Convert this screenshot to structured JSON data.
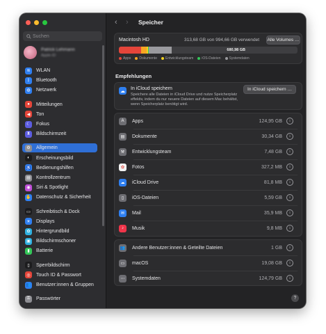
{
  "window": {
    "title": "Speicher"
  },
  "sidebar": {
    "search_placeholder": "Suchen",
    "profile": {
      "name": "Patrick Lehmann",
      "subtitle": "Apple-ID"
    },
    "groups": [
      [
        {
          "label": "WLAN",
          "icon": "wifi-icon",
          "color": "#2f7ff0",
          "glyph": "≋"
        },
        {
          "label": "Bluetooth",
          "icon": "bluetooth-icon",
          "color": "#2f7ff0",
          "glyph": "ᛒ"
        },
        {
          "label": "Netzwerk",
          "icon": "globe-icon",
          "color": "#2f7ff0",
          "glyph": "◍"
        }
      ],
      [
        {
          "label": "Mitteilungen",
          "icon": "bell-icon",
          "color": "#e5453a",
          "glyph": "●"
        },
        {
          "label": "Ton",
          "icon": "speaker-icon",
          "color": "#e5453a",
          "glyph": "◀"
        },
        {
          "label": "Fokus",
          "icon": "moon-icon",
          "color": "#5c5ce0",
          "glyph": "☾"
        },
        {
          "label": "Bildschirmzeit",
          "icon": "hourglass-icon",
          "color": "#5c5ce0",
          "glyph": "⧗"
        }
      ],
      [
        {
          "label": "Allgemein",
          "icon": "gear-icon",
          "color": "#8e8e93",
          "glyph": "⚙",
          "selected": true
        },
        {
          "label": "Erscheinungsbild",
          "icon": "appearance-icon",
          "color": "#1c1c1e",
          "glyph": "◐"
        },
        {
          "label": "Bedienungshilfen",
          "icon": "accessibility-icon",
          "color": "#2f7ff0",
          "glyph": "♿"
        },
        {
          "label": "Kontrollzentrum",
          "icon": "control-center-icon",
          "color": "#8e8e93",
          "glyph": "▤"
        },
        {
          "label": "Siri & Spotlight",
          "icon": "siri-icon",
          "color": "#c04fd8",
          "glyph": "◉"
        },
        {
          "label": "Datenschutz & Sicherheit",
          "icon": "hand-icon",
          "color": "#2f7ff0",
          "glyph": "✋"
        }
      ],
      [
        {
          "label": "Schreibtisch & Dock",
          "icon": "dock-icon",
          "color": "#1c1c1e",
          "glyph": "▭"
        },
        {
          "label": "Displays",
          "icon": "display-icon",
          "color": "#2f7ff0",
          "glyph": "☀"
        },
        {
          "label": "Hintergrundbild",
          "icon": "wallpaper-icon",
          "color": "#2fb0e0",
          "glyph": "✿"
        },
        {
          "label": "Bildschirmschoner",
          "icon": "screensaver-icon",
          "color": "#2fb0e0",
          "glyph": "▣"
        },
        {
          "label": "Batterie",
          "icon": "battery-icon",
          "color": "#34c759",
          "glyph": "▮"
        }
      ],
      [
        {
          "label": "Sperrbildschirm",
          "icon": "lock-screen-icon",
          "color": "#1c1c1e",
          "glyph": "▯"
        },
        {
          "label": "Touch ID & Passwort",
          "icon": "fingerprint-icon",
          "color": "#e5453a",
          "glyph": "◎"
        },
        {
          "label": "Benutzer:innen & Gruppen",
          "icon": "users-icon",
          "color": "#2f7ff0",
          "glyph": "👥"
        }
      ],
      [
        {
          "label": "Passwörter",
          "icon": "key-icon",
          "color": "#8e8e93",
          "glyph": "⚿"
        }
      ]
    ]
  },
  "disk": {
    "name": "Macintosh HD",
    "usage": "313,68 GB von 994,66 GB verwendet",
    "all_volumes_button": "Alle Volumes …",
    "free_label": "680,98 GB",
    "used_fraction": 0.315,
    "segments": [
      {
        "name": "Apps",
        "color": "#e5453a",
        "fraction": 0.1255
      },
      {
        "name": "Dokumente",
        "color": "#f5a623",
        "fraction": 0.0305
      },
      {
        "name": "Entwicklungsteam",
        "color": "#f0d020",
        "fraction": 0.0075
      },
      {
        "name": "iOS-Dateien",
        "color": "#34c759",
        "fraction": 0.0056
      },
      {
        "name": "Systemdaten",
        "color": "#9a9a9e",
        "fraction": 0.1255
      }
    ],
    "legend": [
      {
        "label": "Apps",
        "color": "#e5453a"
      },
      {
        "label": "Dokumente",
        "color": "#f5a623"
      },
      {
        "label": "Entwicklungsteam",
        "color": "#f0d020"
      },
      {
        "label": "iOS-Dateien",
        "color": "#34c759"
      },
      {
        "label": "Systemdaten",
        "color": "#9a9a9e"
      }
    ]
  },
  "recommendations": {
    "heading": "Empfehlungen",
    "item": {
      "title": "In iCloud speichern",
      "description": "Speichere alle Dateien in iCloud Drive und nutze Speicherplatz effektiv, indem du nur neuere Dateien auf diesem Mac behältst, wenn Speicherplatz benötigt wird.",
      "button": "In iCloud speichern …"
    }
  },
  "categories": [
    {
      "label": "Apps",
      "value": "124,95 GB",
      "icon": "apps-icon",
      "color": "#6e6e73",
      "glyph": "A"
    },
    {
      "label": "Dokumente",
      "value": "30,34 GB",
      "icon": "document-icon",
      "color": "#6e6e73",
      "glyph": "▤"
    },
    {
      "label": "Entwicklungsteam",
      "value": "7,48 GB",
      "icon": "hammer-icon",
      "color": "#6e6e73",
      "glyph": "⚒"
    },
    {
      "label": "Fotos",
      "value": "327,2 MB",
      "icon": "photos-icon",
      "color": "#f2f2f2",
      "glyph": "✿"
    },
    {
      "label": "iCloud Drive",
      "value": "81,8 MB",
      "icon": "icloud-icon",
      "color": "#2f7ff0",
      "glyph": "☁"
    },
    {
      "label": "iOS-Dateien",
      "value": "5,59 GB",
      "icon": "iphone-icon",
      "color": "#6e6e73",
      "glyph": "▯"
    },
    {
      "label": "Mail",
      "value": "35,9 MB",
      "icon": "mail-icon",
      "color": "#2f7ff0",
      "glyph": "✉"
    },
    {
      "label": "Musik",
      "value": "9,8 MB",
      "icon": "music-icon",
      "color": "#f0354a",
      "glyph": "♪"
    }
  ],
  "other": [
    {
      "label": "Andere Benutzer:innen & Geteilte Dateien",
      "value": "1 GB",
      "icon": "users-icon",
      "color": "#6e6e73",
      "glyph": "👥"
    },
    {
      "label": "macOS",
      "value": "19,08 GB",
      "icon": "macos-icon",
      "color": "#6e6e73",
      "glyph": "▭"
    },
    {
      "label": "Systemdaten",
      "value": "124,79 GB",
      "icon": "system-data-icon",
      "color": "#6e6e73",
      "glyph": "⋯"
    }
  ]
}
